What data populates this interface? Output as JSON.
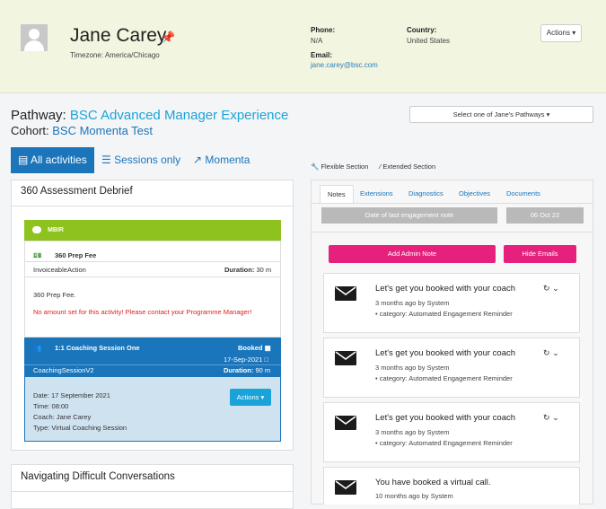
{
  "profile": {
    "name": "Jane Carey",
    "timezone": "Timezone: America/Chicago",
    "phone_label": "Phone:",
    "phone": "N/A",
    "email_label": "Email:",
    "email": "jane.carey@bsc.com",
    "country_label": "Country:",
    "country": "United States",
    "actions_label": "Actions"
  },
  "pathway": {
    "label": "Pathway:",
    "value": "BSC Advanced Manager Experience",
    "cohort_label": "Cohort:",
    "cohort_value": "BSC Momenta Test",
    "select_label": "Select one of Jane's Pathways"
  },
  "tabs": {
    "all": "All activities",
    "sessions": "Sessions only",
    "momenta": "Momenta"
  },
  "legend": {
    "flexible": "Flexible Section",
    "extended": "Extended Section"
  },
  "section1": {
    "title": "360 Assessment Debrief",
    "mbir": "MBIR",
    "prep_title": "360 Prep Fee",
    "prep_type": "InvoiceableAction",
    "duration_label": "Duration:",
    "prep_duration": "30 m",
    "prep_desc": "360 Prep Fee.",
    "prep_warning": "No amount set for this activity! Please contact your Programme Manager!",
    "coach_title": "1:1 Coaching Session One",
    "coach_status": "Booked",
    "coach_date_short": "17-Sep-2021",
    "coach_type": "CoachingSessionV2",
    "coach_duration": "90 m",
    "detail_date": "Date: 17 September 2021",
    "detail_time": "Time: 08:00",
    "detail_coach": "Coach: Jane Carey",
    "detail_type": "Type: Virtual Coaching Session",
    "actions_label": "Actions"
  },
  "section2": {
    "title": "Navigating Difficult Conversations"
  },
  "right": {
    "tabs": [
      "Notes",
      "Extensions",
      "Diagnostics",
      "Objectives",
      "Documents"
    ],
    "last_engagement_label": "Date of last engagement note",
    "last_engagement_value": "06 Oct 22",
    "add_note": "Add Admin Note",
    "hide_emails": "Hide Emails",
    "notes": [
      {
        "title": "Let's get you booked with your coach",
        "meta": "3 months ago by System",
        "category": "• category: Automated Engagement Reminder"
      },
      {
        "title": "Let's get you booked with your coach",
        "meta": "3 months ago by System",
        "category": "• category: Automated Engagement Reminder"
      },
      {
        "title": "Let's get you booked with your coach",
        "meta": "3 months ago by System",
        "category": "• category: Automated Engagement Reminder"
      },
      {
        "title": "You have booked a virtual call.",
        "meta": "10 months ago by System",
        "category": ""
      }
    ]
  },
  "colors": {
    "header_bg": "#f2f5df",
    "primary": "#1a75bb",
    "accent_cyan": "#1aa3d9",
    "mbir_green": "#8dc21f",
    "pink": "#e6217d",
    "warning_red": "#e02020"
  },
  "icons": {
    "pin": "pin-icon",
    "mail": "envelope-icon",
    "refresh": "refresh-icon",
    "chevron": "chevron-down-icon",
    "calendar": "calendar-icon",
    "wrench": "wrench-icon",
    "users": "users-icon"
  }
}
